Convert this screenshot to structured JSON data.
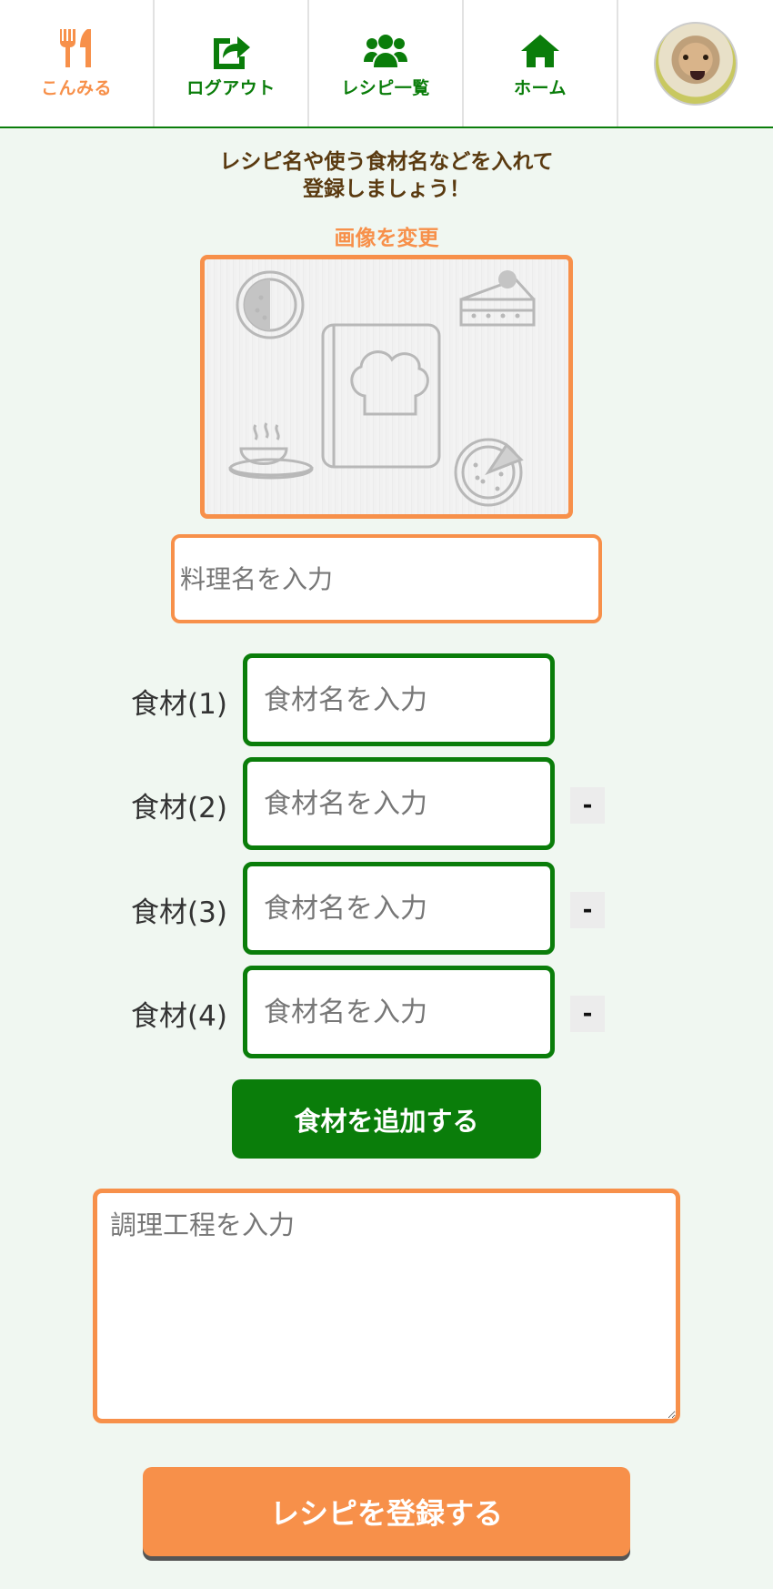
{
  "nav": {
    "items": [
      {
        "label": "こんみる",
        "icon": "fork-knife-icon",
        "active": true
      },
      {
        "label": "ログアウト",
        "icon": "logout-icon"
      },
      {
        "label": "レシピ一覧",
        "icon": "users-icon"
      },
      {
        "label": "ホーム",
        "icon": "home-icon"
      }
    ],
    "avatar": "user-avatar"
  },
  "intro": {
    "line1": "レシピ名や使う食材名などを入れて",
    "line2": "登録しましょう！"
  },
  "image": {
    "change_label": "画像を変更",
    "placeholder_icon": "recipe-book-icon"
  },
  "dish": {
    "placeholder": "料理名を入力",
    "value": ""
  },
  "ingredients": [
    {
      "label": "食材(1)",
      "placeholder": "食材名を入力",
      "value": "",
      "removable": false
    },
    {
      "label": "食材(2)",
      "placeholder": "食材名を入力",
      "value": "",
      "removable": true
    },
    {
      "label": "食材(3)",
      "placeholder": "食材名を入力",
      "value": "",
      "removable": true
    },
    {
      "label": "食材(4)",
      "placeholder": "食材名を入力",
      "value": "",
      "removable": true
    }
  ],
  "remove_label": "-",
  "add_ingredient_label": "食材を追加する",
  "steps": {
    "placeholder": "調理工程を入力",
    "value": ""
  },
  "submit_label": "レシピを登録する",
  "colors": {
    "accent_orange": "#f7904a",
    "accent_green": "#0a7d0a",
    "background": "#f0f7f1",
    "heading_brown": "#5a3a10"
  }
}
